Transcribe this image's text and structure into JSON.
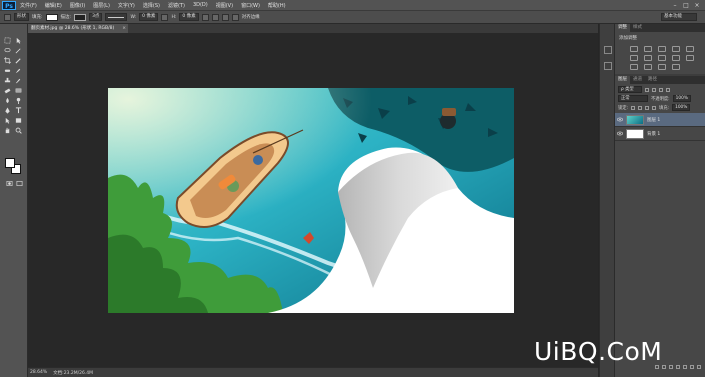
{
  "menu": {
    "logo": "Ps",
    "items": [
      "文件(F)",
      "编辑(E)",
      "图像(I)",
      "图层(L)",
      "文字(Y)",
      "选择(S)",
      "滤镜(T)",
      "3D(D)",
      "视图(V)",
      "窗口(W)",
      "帮助(H)"
    ],
    "window_controls": [
      "–",
      "□",
      "×"
    ]
  },
  "options": {
    "mode": "形状",
    "fill_label": "填充:",
    "stroke_label": "描边:",
    "stroke_width": "3点",
    "w_label": "W:",
    "w_value": "0 像素",
    "h_label": "H:",
    "h_value": "0 像素",
    "align_edges": "对齐边缘",
    "workspace": "基本功能"
  },
  "document": {
    "tab_title": "翻页素材.jpg @ 28.6% (形状 1, RGB/8)",
    "tab_close": "×"
  },
  "status": {
    "zoom": "28.64%",
    "doc_info": "文档:23.2M/26.4M"
  },
  "panels": {
    "adjust_tabs": [
      "调整",
      "样式"
    ],
    "adjust_title": "添加调整",
    "layers_tabs": [
      "图层",
      "通道",
      "路径"
    ],
    "kind_filter": "ρ 类型",
    "blend_mode": "正常",
    "opacity_label": "不透明度:",
    "opacity_value": "100%",
    "lock_label": "锁定:",
    "fill_label": "填充:",
    "fill_value": "100%",
    "layers": [
      {
        "name": "图层 1",
        "selected": true
      },
      {
        "name": "背景 1",
        "selected": false
      }
    ]
  },
  "watermark": "UiBQ.CoM"
}
